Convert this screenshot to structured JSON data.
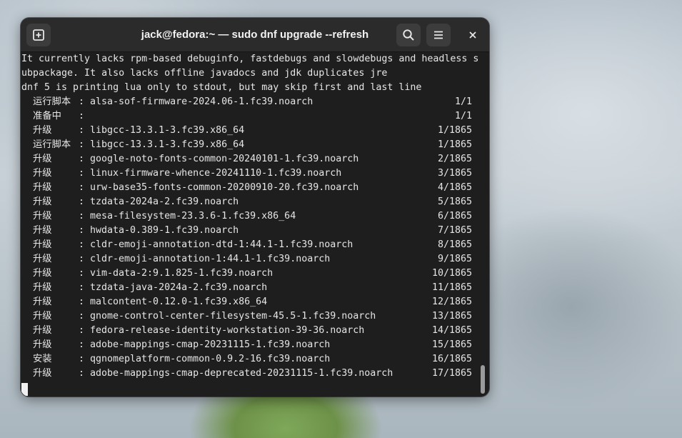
{
  "window": {
    "title": "jack@fedora:~ — sudo dnf upgrade --refresh"
  },
  "icons": {
    "new_tab": "new-tab-icon",
    "search": "search-icon",
    "menu": "hamburger-menu-icon",
    "close": "close-icon"
  },
  "terminal": {
    "text_lines": [
      "It currently lacks rpm-based debuginfo, fastdebugs and slowdebugs and headless s",
      "ubpackage. It also lacks offline javadocs and jdk duplicates jre",
      "dnf 5 is printing lua only to stdout, but may skip first and last line"
    ],
    "rows": [
      {
        "label": "运行脚本",
        "colon": ":",
        "pkg": "alsa-sof-firmware-2024.06-1.fc39.noarch",
        "count": "1/1"
      },
      {
        "label": "准备中",
        "colon": ":",
        "pkg": "",
        "count": "1/1"
      },
      {
        "label": "升级",
        "colon": ":",
        "pkg": "libgcc-13.3.1-3.fc39.x86_64",
        "count": "1/1865"
      },
      {
        "label": "运行脚本",
        "colon": ":",
        "pkg": "libgcc-13.3.1-3.fc39.x86_64",
        "count": "1/1865"
      },
      {
        "label": "升级",
        "colon": ":",
        "pkg": "google-noto-fonts-common-20240101-1.fc39.noarch",
        "count": "2/1865"
      },
      {
        "label": "升级",
        "colon": ":",
        "pkg": "linux-firmware-whence-20241110-1.fc39.noarch",
        "count": "3/1865"
      },
      {
        "label": "升级",
        "colon": ":",
        "pkg": "urw-base35-fonts-common-20200910-20.fc39.noarch",
        "count": "4/1865"
      },
      {
        "label": "升级",
        "colon": ":",
        "pkg": "tzdata-2024a-2.fc39.noarch",
        "count": "5/1865"
      },
      {
        "label": "升级",
        "colon": ":",
        "pkg": "mesa-filesystem-23.3.6-1.fc39.x86_64",
        "count": "6/1865"
      },
      {
        "label": "升级",
        "colon": ":",
        "pkg": "hwdata-0.389-1.fc39.noarch",
        "count": "7/1865"
      },
      {
        "label": "升级",
        "colon": ":",
        "pkg": "cldr-emoji-annotation-dtd-1:44.1-1.fc39.noarch",
        "count": "8/1865"
      },
      {
        "label": "升级",
        "colon": ":",
        "pkg": "cldr-emoji-annotation-1:44.1-1.fc39.noarch",
        "count": "9/1865"
      },
      {
        "label": "升级",
        "colon": ":",
        "pkg": "vim-data-2:9.1.825-1.fc39.noarch",
        "count": "10/1865"
      },
      {
        "label": "升级",
        "colon": ":",
        "pkg": "tzdata-java-2024a-2.fc39.noarch",
        "count": "11/1865"
      },
      {
        "label": "升级",
        "colon": ":",
        "pkg": "malcontent-0.12.0-1.fc39.x86_64",
        "count": "12/1865"
      },
      {
        "label": "升级",
        "colon": ":",
        "pkg": "gnome-control-center-filesystem-45.5-1.fc39.noarch",
        "count": "13/1865"
      },
      {
        "label": "升级",
        "colon": ":",
        "pkg": "fedora-release-identity-workstation-39-36.noarch",
        "count": "14/1865"
      },
      {
        "label": "升级",
        "colon": ":",
        "pkg": "adobe-mappings-cmap-20231115-1.fc39.noarch",
        "count": "15/1865"
      },
      {
        "label": "安装",
        "colon": ":",
        "pkg": "qgnomeplatform-common-0.9.2-16.fc39.noarch",
        "count": "16/1865"
      },
      {
        "label": "升级",
        "colon": ":",
        "pkg": "adobe-mappings-cmap-deprecated-20231115-1.fc39.noarch",
        "count": "17/1865"
      }
    ]
  }
}
